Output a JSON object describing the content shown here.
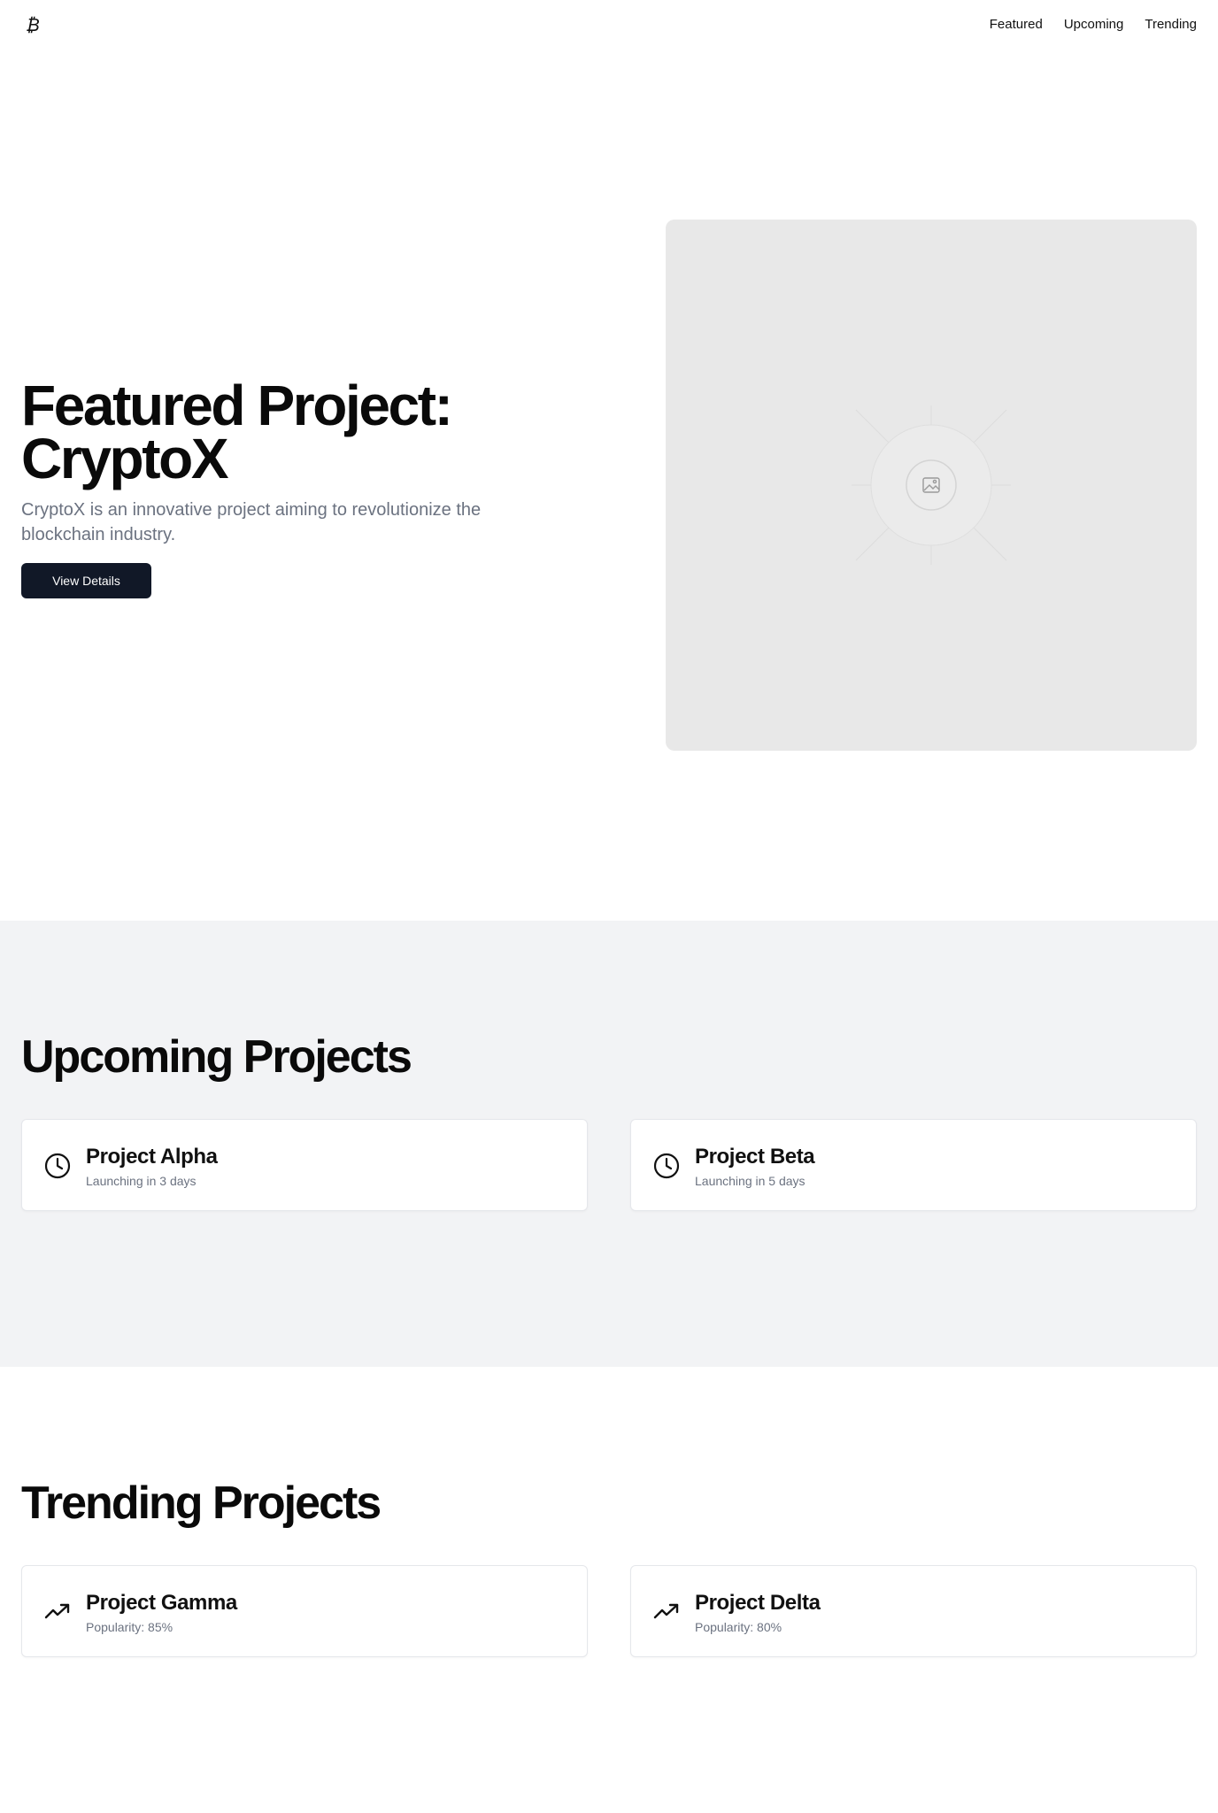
{
  "header": {
    "logo_icon": "bitcoin-icon",
    "nav": [
      {
        "label": "Featured"
      },
      {
        "label": "Upcoming"
      },
      {
        "label": "Trending"
      }
    ]
  },
  "hero": {
    "title_line1": "Featured Project:",
    "title_line2": "CryptoX",
    "description": "CryptoX is an innovative project aiming to revolutionize the blockchain industry.",
    "button_label": "View Details",
    "image_icon": "image-placeholder-icon"
  },
  "upcoming": {
    "title": "Upcoming Projects",
    "items": [
      {
        "name": "Project Alpha",
        "status": "Launching in 3 days",
        "icon": "clock-icon"
      },
      {
        "name": "Project Beta",
        "status": "Launching in 5 days",
        "icon": "clock-icon"
      }
    ]
  },
  "trending": {
    "title": "Trending Projects",
    "items": [
      {
        "name": "Project Gamma",
        "status": "Popularity: 85%",
        "icon": "trending-up-icon"
      },
      {
        "name": "Project Delta",
        "status": "Popularity: 80%",
        "icon": "trending-up-icon"
      }
    ]
  },
  "colors": {
    "primary_button": "#111827",
    "muted_text": "#6b7280",
    "upcoming_bg": "#f2f3f5",
    "media_bg": "#e8e8e8"
  }
}
